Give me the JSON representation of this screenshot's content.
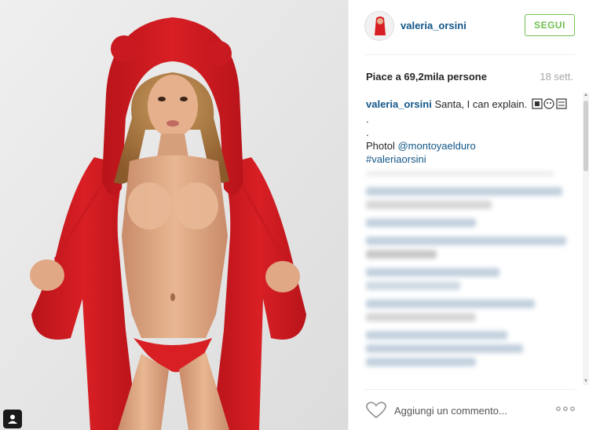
{
  "post": {
    "username": "valeria_orsini",
    "follow_label": "SEGUI",
    "likes_text": "Piace a 69,2mila persone",
    "age": "18 sett.",
    "caption": {
      "username": "valeria_orsini",
      "text": "Santa, I can explain.",
      "line2": ".",
      "line3": ".",
      "photo_prefix": "Photo",
      "photo_credit": "@montoyaelduro",
      "hashtag": "#valeriaorsini"
    }
  },
  "comment_box": {
    "placeholder": "Aggiungi un commento..."
  },
  "icons": [
    "user-tag-icon",
    "heart-icon",
    "more-options-icon"
  ],
  "colors": {
    "link": "#125688",
    "follow": "#70c050",
    "muted": "#a5a7aa",
    "robe": "#d81f24"
  }
}
